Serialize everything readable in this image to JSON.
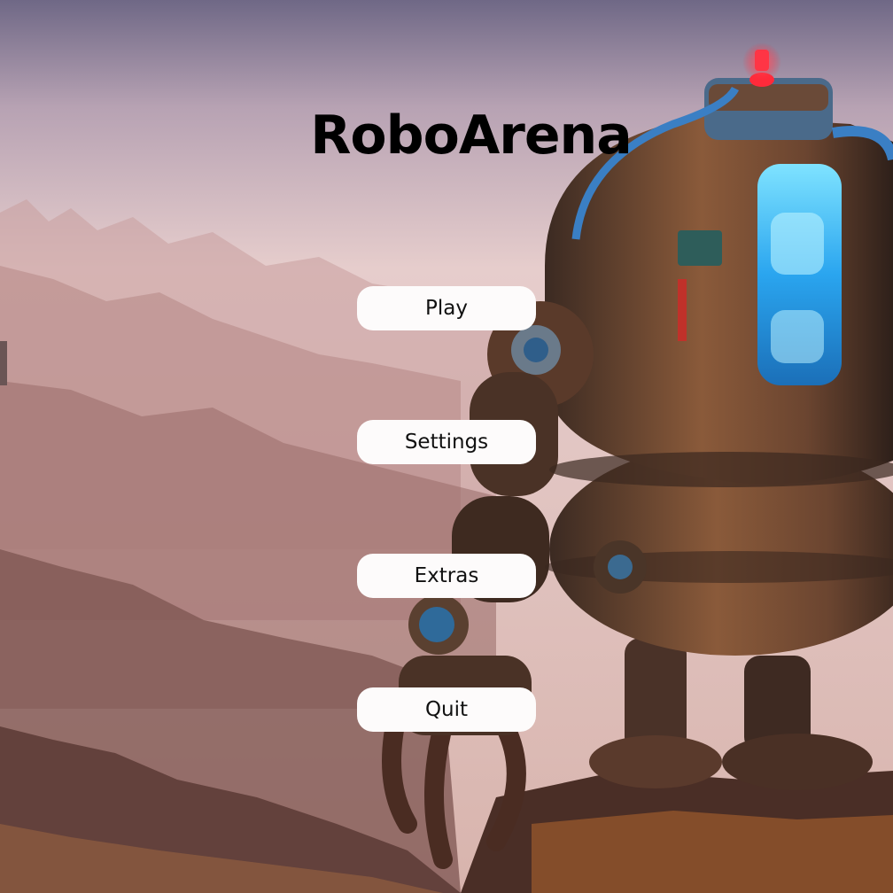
{
  "game": {
    "title": "RoboArena"
  },
  "menu": {
    "play_label": "Play",
    "settings_label": "Settings",
    "extras_label": "Extras",
    "quit_label": "Quit"
  },
  "colors": {
    "button_bg": "#fdfbfb",
    "title_color": "#000000",
    "robot_glow": "#4fc3ff",
    "beacon": "#ff2a3a"
  }
}
